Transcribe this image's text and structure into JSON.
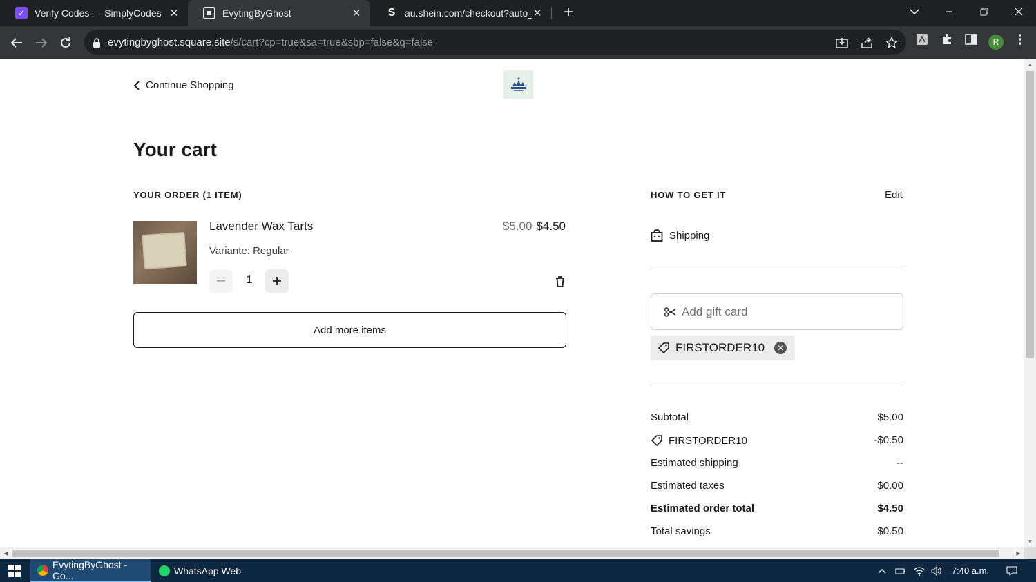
{
  "browser": {
    "tabs": [
      {
        "title": "Verify Codes — SimplyCodes",
        "favicon_color": "#7b4ff5",
        "active": false
      },
      {
        "title": "EvytingByGhost",
        "favicon_color": "#ffffff",
        "active": true
      },
      {
        "title": "au.shein.com/checkout?auto_co",
        "favicon_letter": "S",
        "active": false
      }
    ],
    "url_host": "evytingbyghost.square.site",
    "url_path": "/s/cart?cp=true&sa=true&sbp=false&q=false",
    "profile_initial": "R"
  },
  "page": {
    "continue_label": "Continue Shopping",
    "title": "Your cart",
    "order_label": "YOUR ORDER (1 ITEM)",
    "item": {
      "name": "Lavender Wax Tarts",
      "variant": "Variante: Regular",
      "old_price": "$5.00",
      "price": "$4.50",
      "quantity": "1"
    },
    "add_more_label": "Add more items",
    "how_label": "HOW TO GET IT",
    "edit_label": "Edit",
    "shipping_label": "Shipping",
    "gift_card_placeholder": "Add gift card",
    "coupon_code": "FIRSTORDER10",
    "summary": [
      {
        "label": "Subtotal",
        "value": "$5.00"
      },
      {
        "label": "FIRSTORDER10",
        "value": "-$0.50"
      },
      {
        "label": "Estimated shipping",
        "value": "--"
      },
      {
        "label": "Estimated taxes",
        "value": "$0.00"
      },
      {
        "label": "Estimated order total",
        "value": "$4.50"
      },
      {
        "label": "Total savings",
        "value": "$0.50"
      }
    ]
  },
  "taskbar": {
    "apps": [
      {
        "label": "EvytingByGhost - Go...",
        "active": true
      },
      {
        "label": "WhatsApp Web",
        "active": false
      }
    ],
    "time": "7:40 a.m."
  }
}
